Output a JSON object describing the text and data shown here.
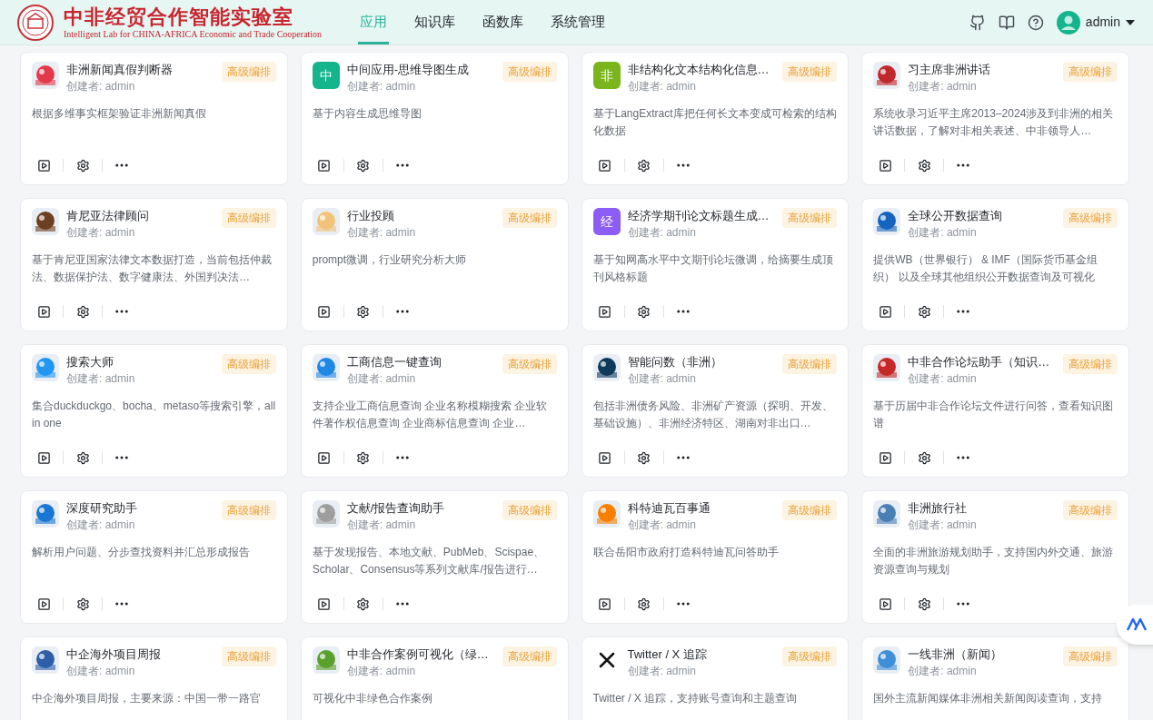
{
  "header": {
    "title": "中非经贸合作智能实验室",
    "subtitle": "Intelligent Lab for CHINA-AFRICA Economic and Trade Cooperation",
    "nav": [
      {
        "label": "应用",
        "selected": true
      },
      {
        "label": "知识库",
        "selected": false
      },
      {
        "label": "函数库",
        "selected": false
      },
      {
        "label": "系统管理",
        "selected": false
      }
    ],
    "user": "admin"
  },
  "apps": [
    {
      "title": "非洲新闻真假判断器",
      "creator": "创建者: admin",
      "badge": "高级编排",
      "description": "根据多维事实框架验证非洲新闻真假"
    },
    {
      "title": "中间应用-思维导图生成",
      "creator": "创建者: admin",
      "badge": "高级编排",
      "description": "基于内容生成思维导图",
      "icon": {
        "kind": "letter",
        "text": "中",
        "color": "#14b48c"
      }
    },
    {
      "title": "非结构化文本结构化信息…",
      "creator": "创建者: admin",
      "badge": "高级编排",
      "description": "基于LangExtract库把任何长文本变成可检索的结构化数据",
      "icon": {
        "kind": "letter",
        "text": "非",
        "color": "#7ab51d"
      }
    },
    {
      "title": "习主席非洲讲话",
      "creator": "创建者: admin",
      "badge": "高级编排",
      "description": "系统收录习近平主席2013–2024涉及到非洲的相关讲话数据，了解对非相关表述、中非领导人…"
    },
    {
      "title": "肯尼亚法律顾问",
      "creator": "创建者: admin",
      "badge": "高级编排",
      "description": "基于肯尼亚国家法律文本数据打造，当前包括仲裁法、数据保护法、数字健康法、外国判决法…"
    },
    {
      "title": "行业投顾",
      "creator": "创建者: admin",
      "badge": "高级编排",
      "description": "prompt微调，行业研究分析大师"
    },
    {
      "title": "经济学期刊论文标题生成…",
      "creator": "创建者: admin",
      "badge": "高级编排",
      "description": "基于知网高水平中文期刊论坛微调，给摘要生成顶刊风格标题",
      "icon": {
        "kind": "letter",
        "text": "经",
        "color": "#8b5cf6"
      }
    },
    {
      "title": "全球公开数据查询",
      "creator": "创建者: admin",
      "badge": "高级编排",
      "description": "提供WB（世界银行） & IMF（国际货币基金组织） 以及全球其他组织公开数据查询及可视化"
    },
    {
      "title": "搜索大师",
      "creator": "创建者: admin",
      "badge": "高级编排",
      "description": "集合duckduckgo、bocha、metaso等搜索引擎，all in one"
    },
    {
      "title": "工商信息一键查询",
      "creator": "创建者: admin",
      "badge": "高级编排",
      "description": "支持企业工商信息查询 企业名称模糊搜索 企业软件著作权信息查询 企业商标信息查询 企业…"
    },
    {
      "title": "智能问数（非洲）",
      "creator": "创建者: admin",
      "badge": "高级编排",
      "description": "包括非洲债务风险、非洲矿产资源（探明、开发、基础设施）、非洲经济特区、湖南对非出口…"
    },
    {
      "title": "中非合作论坛助手（知识…",
      "creator": "创建者: admin",
      "badge": "高级编排",
      "description": "基于历届中非合作论坛文件进行问答，查看知识图谱"
    },
    {
      "title": "深度研究助手",
      "creator": "创建者: admin",
      "badge": "高级编排",
      "description": "解析用户问题、分步查找资料并汇总形成报告"
    },
    {
      "title": "文献/报告查询助手",
      "creator": "创建者: admin",
      "badge": "高级编排",
      "description": "基于发现报告、本地文献、PubMeb、Scispae、Scholar、Consensus等系列文献库/报告进行…"
    },
    {
      "title": "科特迪瓦百事通",
      "creator": "创建者: admin",
      "badge": "高级编排",
      "description": "联合岳阳市政府打造科特迪瓦问答助手"
    },
    {
      "title": "非洲旅行社",
      "creator": "创建者: admin",
      "badge": "高级编排",
      "description": "全面的非洲旅游规划助手，支持国内外交通、旅游资源查询与规划"
    },
    {
      "title": "中企海外项目周报",
      "creator": "创建者: admin",
      "badge": "高级编排",
      "description": "中企海外项目周报，主要来源：中国一带一路官",
      "toolbar": false
    },
    {
      "title": "中非合作案例可视化（绿…",
      "creator": "创建者: admin",
      "badge": "高级编排",
      "description": "可视化中非绿色合作案例",
      "toolbar": false
    },
    {
      "title": "Twitter / X 追踪",
      "creator": "创建者: admin",
      "badge": "高级编排",
      "description": "Twitter / X 追踪，支持账号查询和主题查询",
      "toolbar": false,
      "icon": {
        "kind": "x-logo",
        "color": "#111111"
      }
    },
    {
      "title": "一线非洲（新闻）",
      "creator": "创建者: admin",
      "badge": "高级编排",
      "description": "国外主流新闻媒体非洲相关新闻阅读查询，支持",
      "toolbar": false
    }
  ]
}
